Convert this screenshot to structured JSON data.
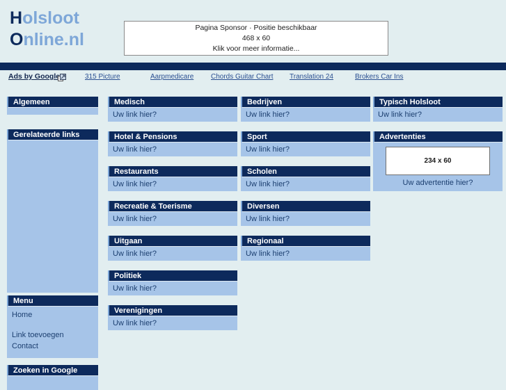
{
  "site": {
    "logo_line1_cap": "H",
    "logo_line1_rest": "olsloot",
    "logo_line2_cap": "O",
    "logo_line2_rest": "nline.nl"
  },
  "colors": {
    "navy": "#0d2a5c",
    "light_blue": "#a6c4e8",
    "page_bg": "#e2eef0",
    "logo_light": "#7ea7d8",
    "link": "#2a4f91"
  },
  "sponsor": {
    "line1": "Pagina Sponsor · Positie beschikbaar",
    "line2": "468 x 60",
    "line3": "Klik voor meer informatie..."
  },
  "ads": {
    "label": "Ads by Google",
    "icon": "external-link-icon",
    "links": [
      "315 Picture",
      "Aarpmedicare",
      "Chords Guitar Chart",
      "Translation 24",
      "Brokers Car Ins"
    ]
  },
  "sidebar": {
    "algemeen": {
      "title": "Algemeen"
    },
    "gerelateerde": {
      "title": "Gerelateerde links"
    },
    "menu": {
      "title": "Menu",
      "items": [
        "Home",
        "Link toevoegen",
        "Contact"
      ]
    },
    "zoeken": {
      "title": "Zoeken in Google"
    }
  },
  "link_placeholder": "Uw link hier?",
  "columns": {
    "col1": [
      {
        "title": "Medisch",
        "link": "Uw link hier?"
      },
      {
        "title": "Hotel & Pensions",
        "link": "Uw link hier?"
      },
      {
        "title": "Restaurants",
        "link": "Uw link hier?"
      },
      {
        "title": "Recreatie & Toerisme",
        "link": "Uw link hier?"
      },
      {
        "title": "Uitgaan",
        "link": "Uw link hier?"
      },
      {
        "title": "Politiek",
        "link": "Uw link hier?"
      },
      {
        "title": "Verenigingen",
        "link": "Uw link hier?"
      }
    ],
    "col2": [
      {
        "title": "Bedrijven",
        "link": "Uw link hier?"
      },
      {
        "title": "Sport",
        "link": "Uw link hier?"
      },
      {
        "title": "Scholen",
        "link": "Uw link hier?"
      },
      {
        "title": "Diversen",
        "link": "Uw link hier?"
      },
      {
        "title": "Regionaal",
        "link": "Uw link hier?"
      }
    ],
    "col3": [
      {
        "title": "Typisch Holsloot",
        "link": "Uw link hier?"
      }
    ]
  },
  "advertenties": {
    "title": "Advertenties",
    "box_label": "234 x 60",
    "caption": "Uw advertentie hier?"
  }
}
